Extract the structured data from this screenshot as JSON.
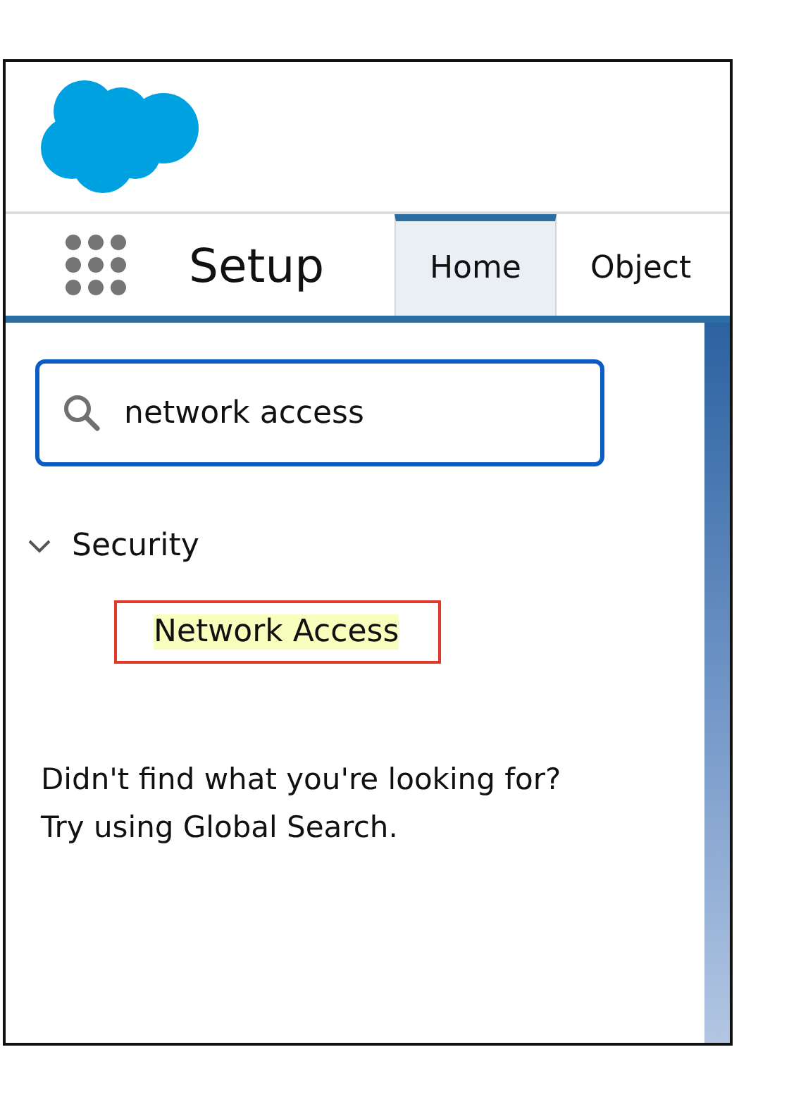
{
  "header": {
    "app_title": "Setup"
  },
  "tabs": [
    {
      "label": "Home",
      "selected": true
    },
    {
      "label": "Object",
      "selected": false
    }
  ],
  "search": {
    "value": "network access"
  },
  "tree": [
    {
      "label": "Security",
      "expanded": true,
      "children": [
        {
          "label": "Network Access",
          "highlighted": true
        }
      ]
    }
  ],
  "message": [
    "Didn't find what you're looking for?",
    "Try using Global Search."
  ]
}
